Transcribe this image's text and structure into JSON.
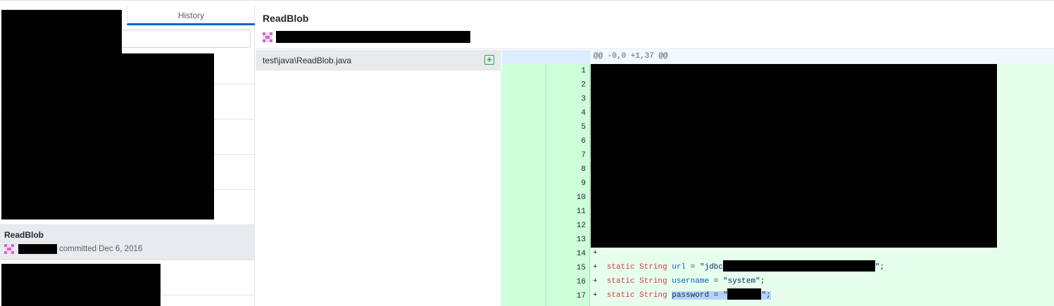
{
  "left_panel": {
    "tab_history": "History",
    "search_placeholder": "",
    "selected_commit": {
      "title": "ReadBlob",
      "meta": "committed Dec 6, 2016"
    }
  },
  "header": {
    "title": "ReadBlob"
  },
  "files": [
    {
      "path": "test\\java\\ReadBlob.java",
      "status_icon": "plus-square-icon"
    }
  ],
  "diff": {
    "hunk_header": "@@ -0,0 +1,37 @@",
    "line_numbers": [
      "1",
      "2",
      "3",
      "4",
      "5",
      "6",
      "7",
      "8",
      "9",
      "10",
      "11",
      "12",
      "13",
      "14",
      "15",
      "16",
      "17"
    ],
    "visible_lines": {
      "l14": "+",
      "l15": {
        "prefix": "+  ",
        "kw1": "static",
        "kw2": "String",
        "id": "url",
        "eq": " = ",
        "str_open": "\"jdbc",
        "str_close": "\";"
      },
      "l16": {
        "prefix": "+  ",
        "kw1": "static",
        "kw2": "String",
        "id": "username",
        "eq": " = ",
        "str": "\"system\"",
        "end": ";"
      },
      "l17": {
        "prefix": "+  ",
        "kw1": "static",
        "kw2": "String",
        "sel_text": "password = \"",
        "end": "\";"
      }
    }
  },
  "colors": {
    "accent": "#0366d6",
    "added_bg": "#e6ffed",
    "added_gutter": "#cdffd8",
    "keyword": "#d73a49",
    "identifier": "#005cc5"
  }
}
